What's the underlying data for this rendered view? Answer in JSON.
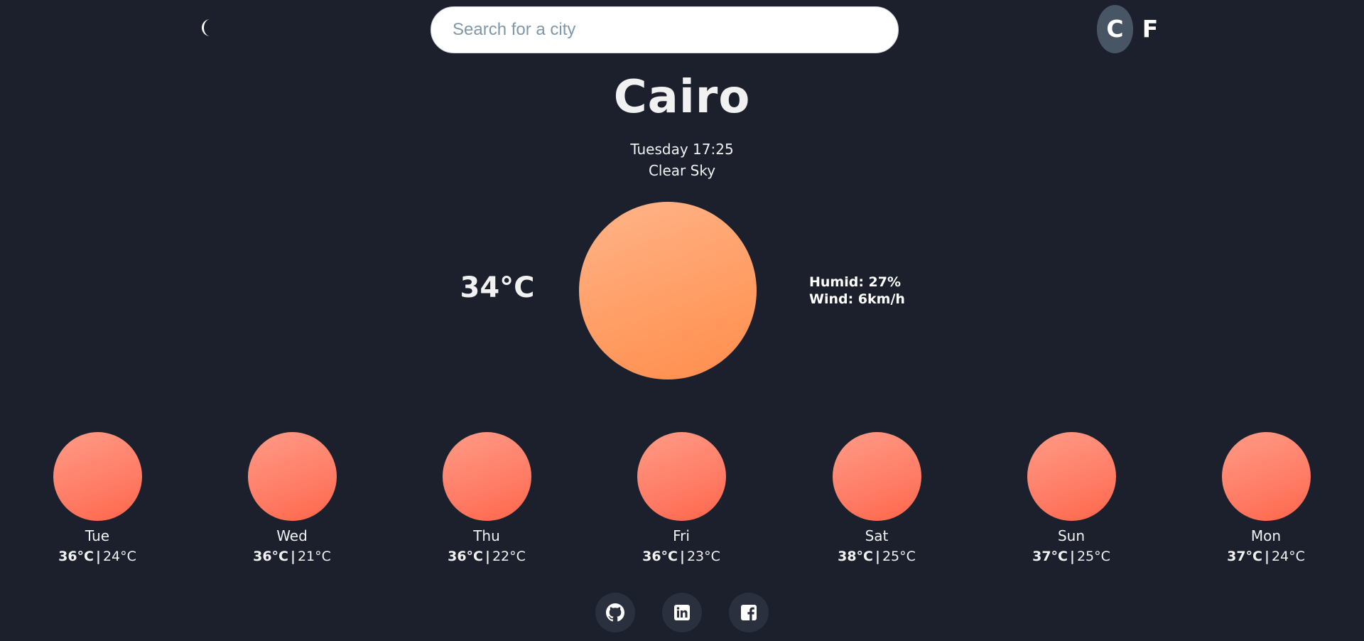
{
  "header": {
    "theme_icon": "moon-icon",
    "search": {
      "placeholder": "Search for a city",
      "value": ""
    },
    "units": {
      "celsius_label": "C",
      "fahrenheit_label": "F",
      "selected": "C"
    }
  },
  "current": {
    "city": "Cairo",
    "datetime": "Tuesday 17:25",
    "condition": "Clear Sky",
    "temperature": "34°C",
    "humidity": "Humid: 27%",
    "wind": "Wind: 6km/h",
    "icon": "sun-icon"
  },
  "forecast": [
    {
      "day": "Tue",
      "high": "36°C",
      "low": "24°C",
      "icon": "sun-icon"
    },
    {
      "day": "Wed",
      "high": "36°C",
      "low": "21°C",
      "icon": "sun-icon"
    },
    {
      "day": "Thu",
      "high": "36°C",
      "low": "22°C",
      "icon": "sun-icon"
    },
    {
      "day": "Fri",
      "high": "36°C",
      "low": "23°C",
      "icon": "sun-icon"
    },
    {
      "day": "Sat",
      "high": "38°C",
      "low": "25°C",
      "icon": "sun-icon"
    },
    {
      "day": "Sun",
      "high": "37°C",
      "low": "25°C",
      "icon": "sun-icon"
    },
    {
      "day": "Mon",
      "high": "37°C",
      "low": "24°C",
      "icon": "sun-icon"
    }
  ],
  "footer": {
    "links": [
      {
        "icon": "github-icon"
      },
      {
        "icon": "linkedin-icon"
      },
      {
        "icon": "facebook-icon"
      }
    ]
  },
  "colors": {
    "background": "#1b202c",
    "sun_current": "#ff9e66",
    "sun_forecast": "#ff7c66",
    "unit_active_bg": "#475565"
  }
}
